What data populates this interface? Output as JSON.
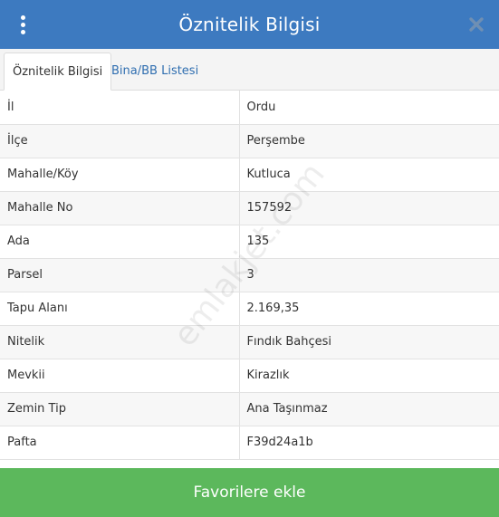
{
  "header": {
    "title": "Öznitelik Bilgisi",
    "menu_icon": "vertical-dots-icon",
    "close_icon": "close-icon",
    "bg_color": "#3d7ac0"
  },
  "tabs": [
    {
      "label": "Öznitelik Bilgisi",
      "active": true
    },
    {
      "label": "Bina/BB Listesi",
      "active": false
    }
  ],
  "rows": [
    {
      "key": "İl",
      "value": "Ordu"
    },
    {
      "key": "İlçe",
      "value": "Perşembe"
    },
    {
      "key": "Mahalle/Köy",
      "value": "Kutluca"
    },
    {
      "key": "Mahalle No",
      "value": "157592"
    },
    {
      "key": "Ada",
      "value": "135"
    },
    {
      "key": "Parsel",
      "value": "3"
    },
    {
      "key": "Tapu Alanı",
      "value": "2.169,35"
    },
    {
      "key": "Nitelik",
      "value": "Fındık Bahçesi"
    },
    {
      "key": "Mevkii",
      "value": "Kirazlık"
    },
    {
      "key": "Zemin Tip",
      "value": "Ana Taşınmaz"
    },
    {
      "key": "Pafta",
      "value": "F39d24a1b"
    }
  ],
  "footer": {
    "button_label": "Favorilere ekle",
    "bg_color": "#5cb85c"
  },
  "watermark": "emlakjet.com"
}
